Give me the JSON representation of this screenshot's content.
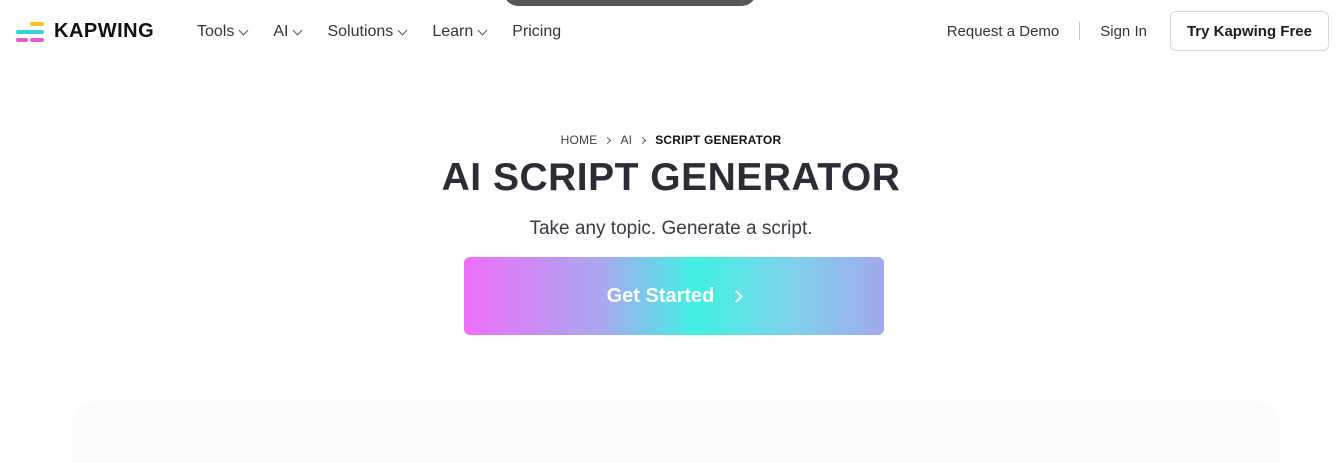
{
  "brand": {
    "name": "KAPWING",
    "logo_colors": [
      "#f8c51c",
      "#35d6d5",
      "#e85bc8"
    ]
  },
  "nav": {
    "items": [
      {
        "label": "Tools",
        "has_dropdown": true
      },
      {
        "label": "AI",
        "has_dropdown": true
      },
      {
        "label": "Solutions",
        "has_dropdown": true
      },
      {
        "label": "Learn",
        "has_dropdown": true
      },
      {
        "label": "Pricing",
        "has_dropdown": false
      }
    ]
  },
  "header_actions": {
    "demo_label": "Request a Demo",
    "signin_label": "Sign In",
    "try_label": "Try Kapwing Free"
  },
  "breadcrumb": {
    "home": "HOME",
    "parent": "AI",
    "current": "SCRIPT GENERATOR"
  },
  "hero": {
    "title": "AI SCRIPT GENERATOR",
    "subtitle": "Take any topic. Generate a script.",
    "cta_label": "Get Started"
  }
}
